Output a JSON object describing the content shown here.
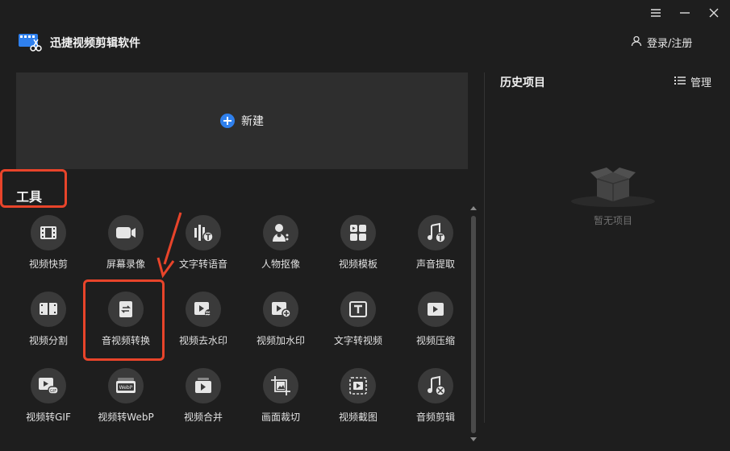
{
  "app": {
    "title": "迅捷视频剪辑软件"
  },
  "header": {
    "login_label": "登录/注册"
  },
  "new_project": {
    "label": "新建"
  },
  "tools": {
    "title": "工具",
    "items": [
      {
        "label": "视频快剪",
        "icon": "film-icon"
      },
      {
        "label": "屏幕录像",
        "icon": "camera-icon"
      },
      {
        "label": "文字转语音",
        "icon": "text-to-speech-icon"
      },
      {
        "label": "人物抠像",
        "icon": "person-cutout-icon"
      },
      {
        "label": "视频模板",
        "icon": "template-icon"
      },
      {
        "label": "声音提取",
        "icon": "music-extract-icon"
      },
      {
        "label": "视频分割",
        "icon": "video-split-icon"
      },
      {
        "label": "音视频转换",
        "icon": "convert-icon"
      },
      {
        "label": "视频去水印",
        "icon": "remove-watermark-icon"
      },
      {
        "label": "视频加水印",
        "icon": "add-watermark-icon"
      },
      {
        "label": "文字转视频",
        "icon": "text-to-video-icon"
      },
      {
        "label": "视频压缩",
        "icon": "compress-icon"
      },
      {
        "label": "视频转GIF",
        "icon": "gif-icon"
      },
      {
        "label": "视频转WebP",
        "icon": "webp-icon"
      },
      {
        "label": "视频合并",
        "icon": "merge-icon"
      },
      {
        "label": "画面裁切",
        "icon": "crop-icon"
      },
      {
        "label": "视频截图",
        "icon": "screenshot-icon"
      },
      {
        "label": "音频剪辑",
        "icon": "audio-cut-icon"
      }
    ]
  },
  "history": {
    "title": "历史项目",
    "manage_label": "管理",
    "empty_label": "暂无项目"
  },
  "colors": {
    "background": "#1e1e1e",
    "card": "#2e2e2e",
    "accent": "#2f80ed",
    "highlight": "#e8442a"
  }
}
